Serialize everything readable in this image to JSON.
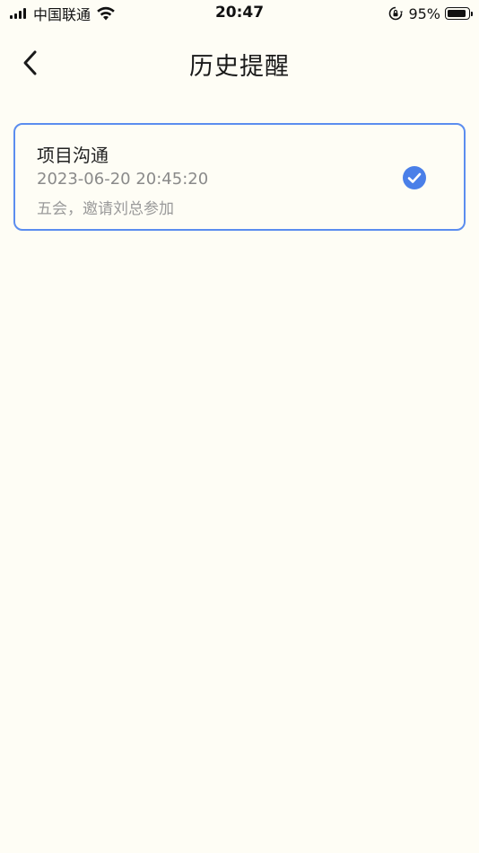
{
  "status_bar": {
    "carrier": "中国联通",
    "time": "20:47",
    "battery_percent": "95%",
    "battery_level": 0.95,
    "icons": [
      "signal-icon",
      "wifi-icon",
      "rotation-lock-icon",
      "battery-icon"
    ]
  },
  "nav": {
    "back_icon": "chevron-left-icon",
    "title": "历史提醒"
  },
  "reminders": [
    {
      "title": "项目沟通",
      "datetime": "2023-06-20 20:45:20",
      "description": "五会，邀请刘总参加",
      "status_icon": "check-circle-icon",
      "checked": true
    }
  ],
  "colors": {
    "background": "#FEFDF5",
    "accent": "#4A7FE8",
    "card_border": "#5B8DEF",
    "secondary_text": "#8a8a8a"
  }
}
